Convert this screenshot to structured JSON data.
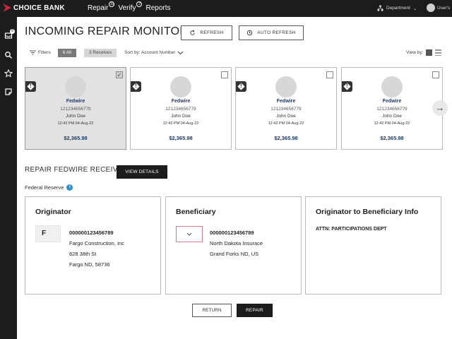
{
  "app": {
    "logo_text": "CHOICE BANK",
    "brand_color": "#d0243c"
  },
  "nav": {
    "items": [
      {
        "label": "Repair",
        "badge": "10"
      },
      {
        "label": "Verify",
        "badge": "2"
      },
      {
        "label": "Reports",
        "badge": ""
      }
    ]
  },
  "header": {
    "department_label": "Department",
    "user_label": "User's"
  },
  "sidebar": {
    "icons": [
      "inbox-icon",
      "search-icon",
      "star-icon",
      "note-icon"
    ],
    "inbox_badge": "8"
  },
  "page": {
    "title": "INCOMING REPAIR MONITOR",
    "refresh_label": "REFRESH",
    "auto_refresh_label": "AUTO REFRESH"
  },
  "filters": {
    "label": "Filters",
    "chip_all": "6 All",
    "chip_receives": "3 Receives",
    "sort_label": "Sort by: Account Number",
    "view_by_label": "View by:"
  },
  "cards": [
    {
      "type": "Fedwire",
      "account": "121234656779",
      "name": "John Doe",
      "time": "12:42 PM 04-Aug-22",
      "amount": "$2,365.98",
      "selected": true
    },
    {
      "type": "Fedwire",
      "account": "121234656779",
      "name": "John Doe",
      "time": "12:42 PM 04-Aug-22",
      "amount": "$2,365.98",
      "selected": false
    },
    {
      "type": "Fedwire",
      "account": "121234656779",
      "name": "John Doe",
      "time": "12:42 PM 04-Aug-22",
      "amount": "$2,365.98",
      "selected": false
    },
    {
      "type": "Fedwire",
      "account": "121234656779",
      "name": "John Doe",
      "time": "12:42 PM 04-Aug-22",
      "amount": "$2,365.98",
      "selected": false
    }
  ],
  "detail": {
    "section_title": "REPAIR FEDWIRE RECEIVE",
    "view_details_label": "VIEW DETAILS",
    "federal_reserve_label": "Federal Reserve",
    "info_glyph": "i"
  },
  "originator": {
    "title": "Originator",
    "select_value": "F",
    "account": "000000123456789",
    "line1": "Fargo Construction, Inc",
    "line2": "828 38th St",
    "line3": "Fargo ND, 58736"
  },
  "beneficiary": {
    "title": "Beneficiary",
    "account": "000000123456789",
    "line1": "North Dakota Insurace",
    "line2": "Grand Forks ND, US"
  },
  "info_panel": {
    "title": "Originator to Beneficiary Info",
    "text": "ATTN: PARTICIPATIONS DEPT"
  },
  "actions": {
    "return_label": "RETURN",
    "repair_label": "REPAIR"
  }
}
